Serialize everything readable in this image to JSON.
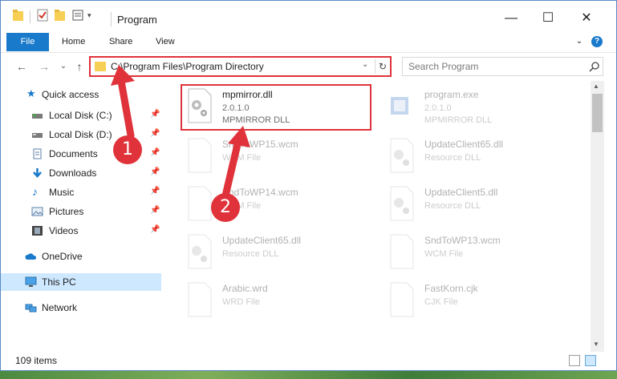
{
  "window": {
    "title": "Program",
    "controls": {
      "minimize": "—",
      "maximize": "☐",
      "close": "✕"
    }
  },
  "ribbon": {
    "file_tab": "File",
    "tabs": [
      "Home",
      "Share",
      "View"
    ],
    "expand": "⌄",
    "help": "?"
  },
  "nav": {
    "back": "←",
    "forward": "→",
    "recent": "⌄",
    "up": "↑",
    "address": "C:\\Program Files\\Program Directory",
    "search_placeholder": "Search Program"
  },
  "sidebar": {
    "items": [
      {
        "label": "Quick access",
        "icon": "star-icon",
        "pinned": false
      },
      {
        "label": "Local Disk (C:)",
        "icon": "drive-icon",
        "pinned": true
      },
      {
        "label": "Local Disk (D:)",
        "icon": "drive-icon",
        "pinned": true
      },
      {
        "label": "Documents",
        "icon": "documents-icon",
        "pinned": true
      },
      {
        "label": "Downloads",
        "icon": "download-icon",
        "pinned": true
      },
      {
        "label": "Music",
        "icon": "music-icon",
        "pinned": true
      },
      {
        "label": "Pictures",
        "icon": "pictures-icon",
        "pinned": true
      },
      {
        "label": "Videos",
        "icon": "videos-icon",
        "pinned": true
      },
      {
        "label": "OneDrive",
        "icon": "cloud-icon",
        "pinned": false
      },
      {
        "label": "This PC",
        "icon": "computer-icon",
        "pinned": false,
        "selected": true
      },
      {
        "label": "Network",
        "icon": "network-icon",
        "pinned": false
      }
    ]
  },
  "files": [
    {
      "name": "mpmirror.dll",
      "line2": "2.0.1.0",
      "line3": "MPMIRROR DLL",
      "type": "dll",
      "highlighted": true
    },
    {
      "name": "program.exe",
      "line2": "2.0.1.0",
      "line3": "MPMIRROR DLL",
      "type": "exe"
    },
    {
      "name": "SndToWP15.wcm",
      "line2": "WCM File",
      "type": "doc"
    },
    {
      "name": "UpdateClient65.dll",
      "line2": "Resource DLL",
      "type": "dll"
    },
    {
      "name": "SndToWP14.wcm",
      "line2": "WCM File",
      "type": "doc"
    },
    {
      "name": "UpdateClient5.dll",
      "line2": "Resource DLL",
      "type": "dll"
    },
    {
      "name": "UpdateClient65.dll",
      "line2": "Resource DLL",
      "type": "dll"
    },
    {
      "name": "SndToWP13.wcm",
      "line2": "WCM File",
      "type": "doc"
    },
    {
      "name": "Arabic.wrd",
      "line2": "WRD File",
      "type": "doc"
    },
    {
      "name": "FastKorn.cjk",
      "line2": "CJK File",
      "type": "doc"
    }
  ],
  "status": {
    "items": "109 items"
  },
  "annotations": {
    "step1": "1",
    "step2": "2"
  },
  "colors": {
    "accent": "#1979ca",
    "highlight": "#e0323a",
    "selected": "#cde8ff"
  }
}
